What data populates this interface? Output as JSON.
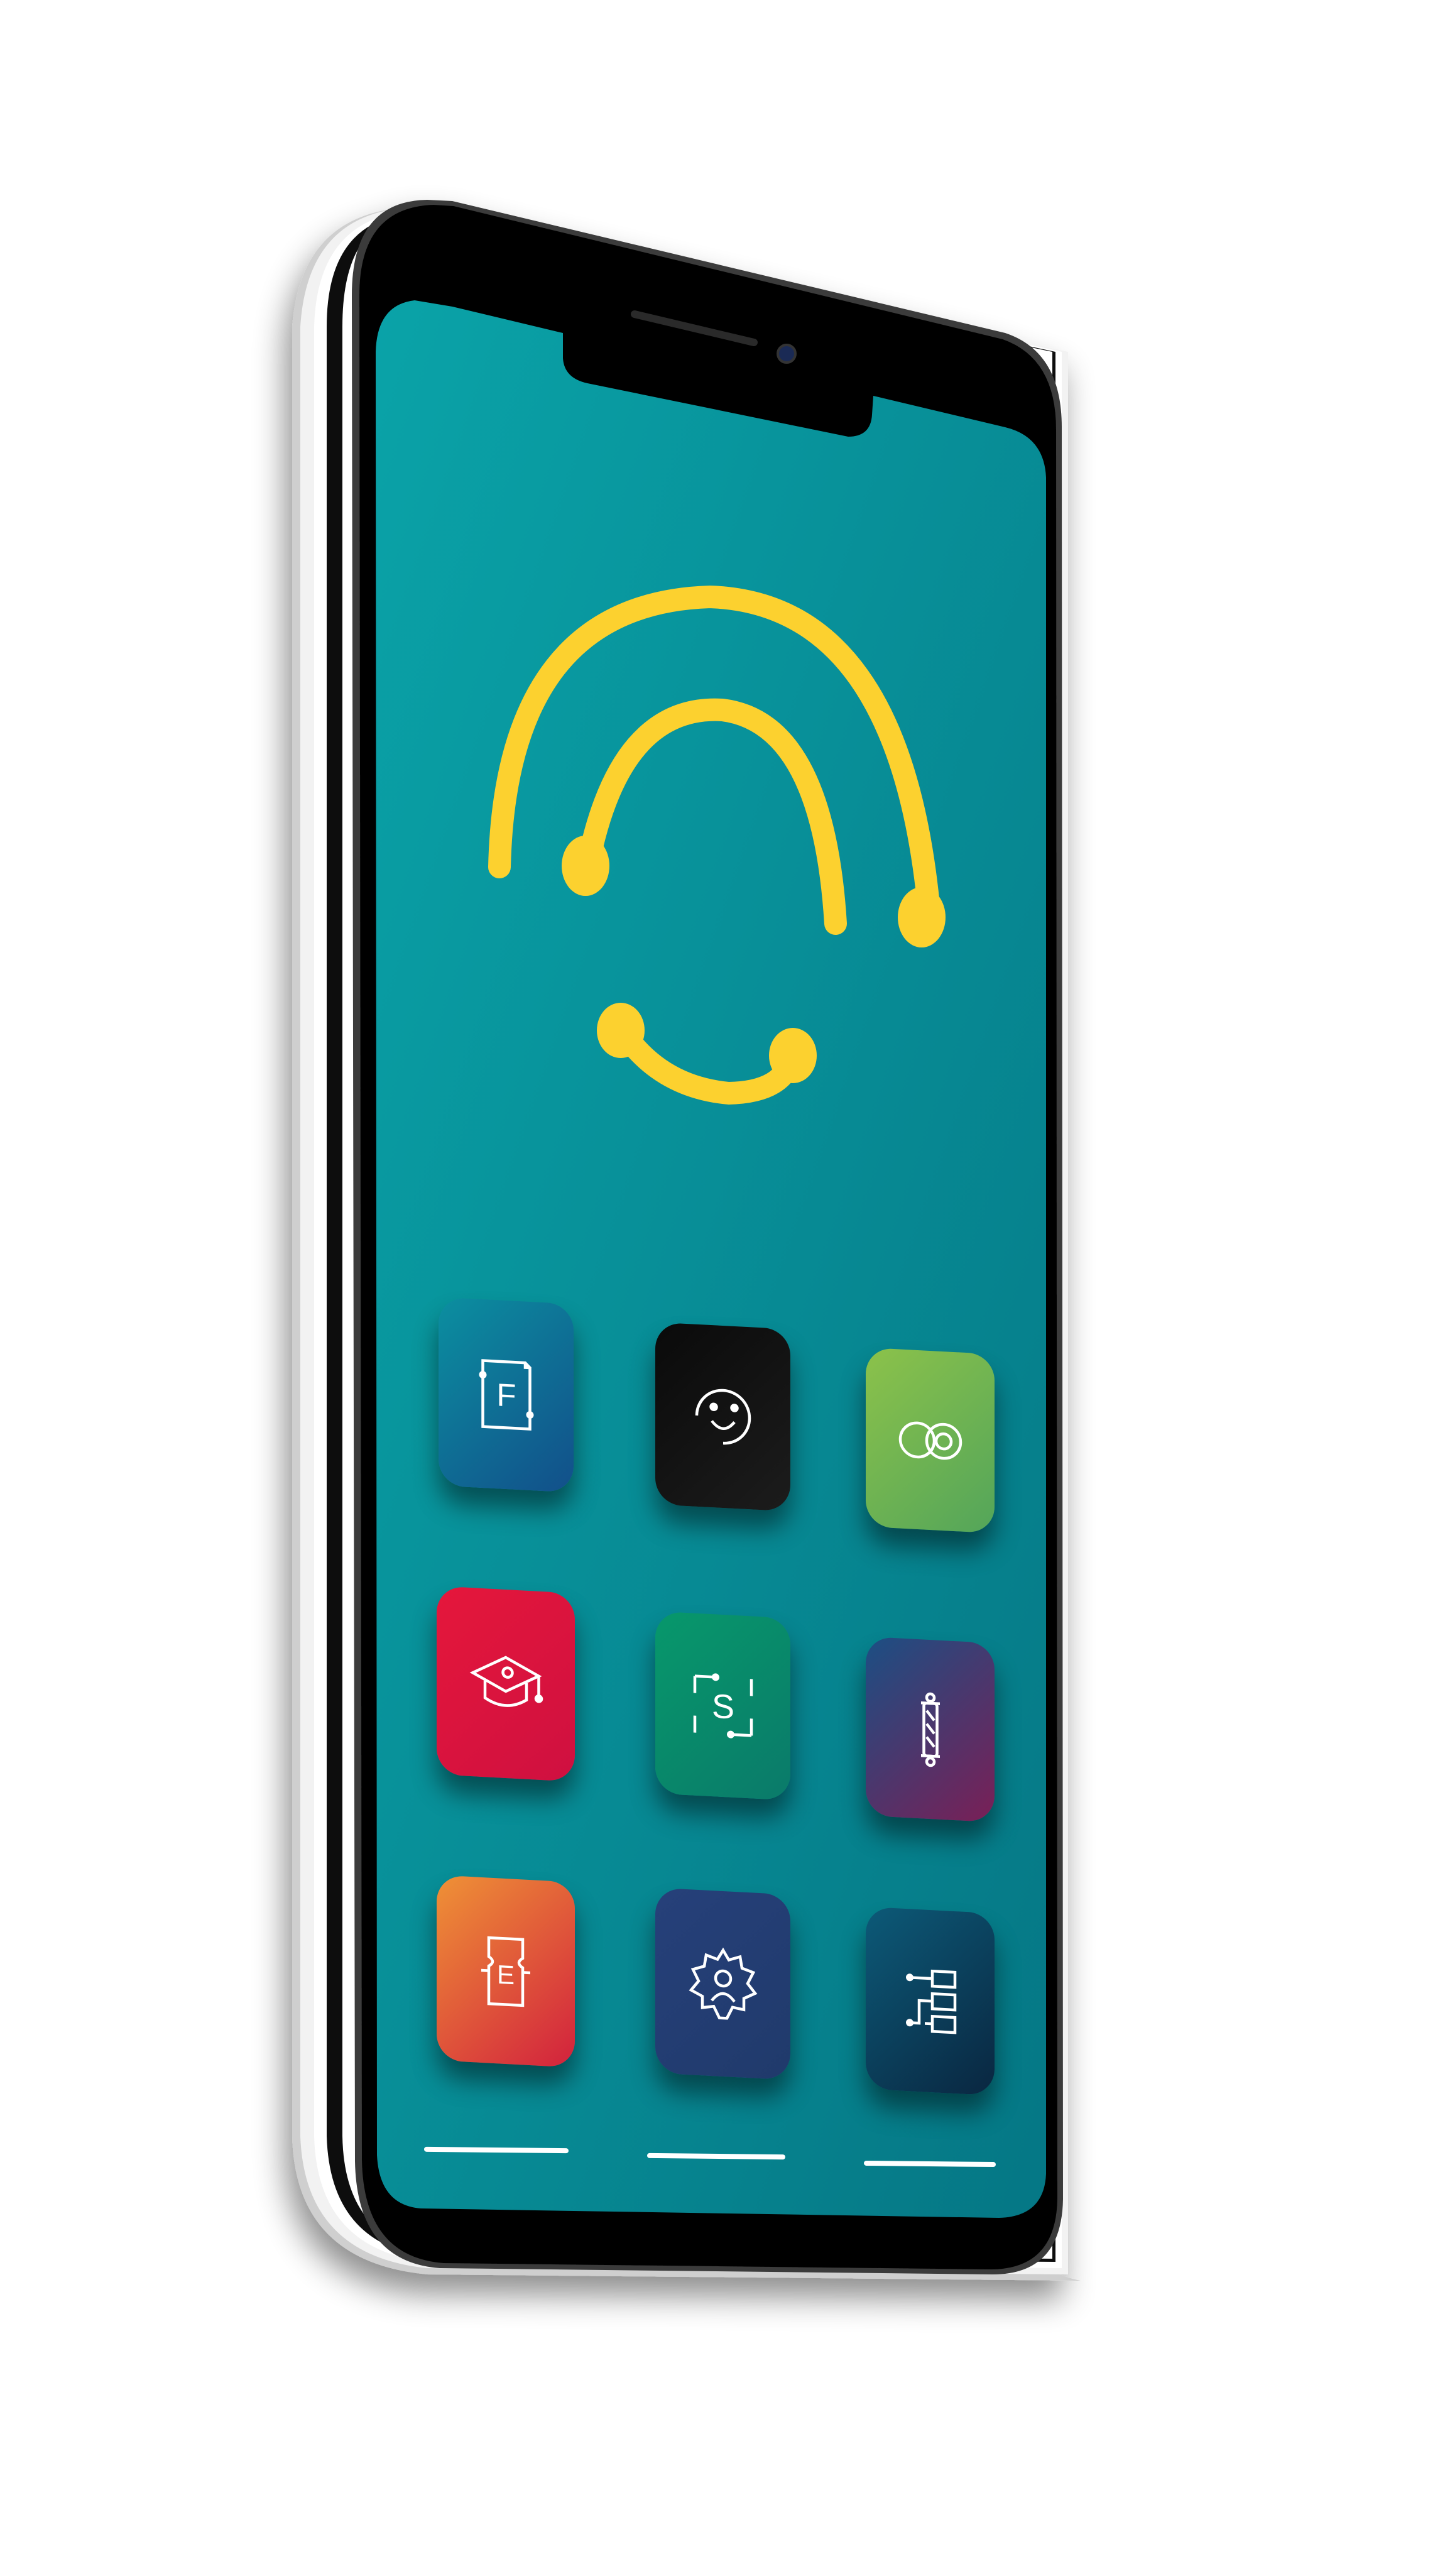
{
  "screen": {
    "background_start": "#0aa3a8",
    "background_end": "#057785"
  },
  "hero_logo": {
    "icon": "yellow-smiley-arc-logo-icon",
    "color": "#fcd12f"
  },
  "apps": [
    {
      "icon": "document-f-icon",
      "letter": "F",
      "gradient": [
        "#0b8fa0",
        "#124f8a"
      ]
    },
    {
      "icon": "circle-swirl-icon",
      "letter": "",
      "gradient": [
        "#0a0a0a",
        "#1c1c1c"
      ]
    },
    {
      "icon": "infinity-loop-icon",
      "letter": "",
      "gradient": [
        "#8cc24a",
        "#53a55a"
      ]
    },
    {
      "icon": "graduation-cap-icon",
      "letter": "",
      "gradient": [
        "#e5173b",
        "#cf1040"
      ]
    },
    {
      "icon": "circuit-s-icon",
      "letter": "S",
      "gradient": [
        "#07986b",
        "#0a7a6a"
      ]
    },
    {
      "icon": "barber-pole-icon",
      "letter": "",
      "gradient": [
        "#1b4f84",
        "#7a1f56"
      ]
    },
    {
      "icon": "ticket-e-icon",
      "letter": "E",
      "gradient": [
        "#ef9236",
        "#d2213d"
      ]
    },
    {
      "icon": "gear-person-icon",
      "letter": "",
      "gradient": [
        "#26407a",
        "#203a6b"
      ]
    },
    {
      "icon": "circuit-blocks-icon",
      "letter": "",
      "gradient": [
        "#0c5a78",
        "#0a2640"
      ]
    }
  ],
  "dock": {
    "indicator_count": 3
  }
}
